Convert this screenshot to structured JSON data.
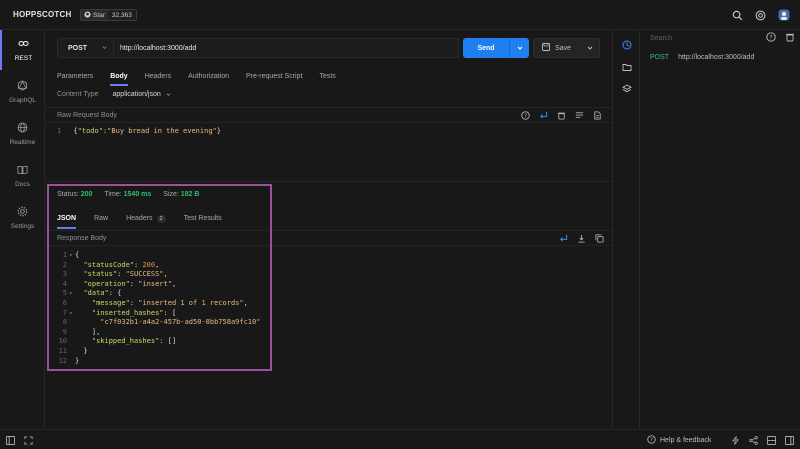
{
  "app": {
    "brand": "HOPPSCOTCH",
    "github": {
      "star_label": "Star",
      "star_count": "32,363"
    }
  },
  "sidebar": {
    "items": [
      {
        "label": "REST",
        "icon": "link-icon",
        "active": true
      },
      {
        "label": "GraphQL",
        "icon": "graphql-icon",
        "active": false
      },
      {
        "label": "Realtime",
        "icon": "globe-icon",
        "active": false
      },
      {
        "label": "Docs",
        "icon": "book-icon",
        "active": false
      },
      {
        "label": "Settings",
        "icon": "gear-icon",
        "active": false
      }
    ]
  },
  "request": {
    "method": "POST",
    "url": "http://localhost:3000/add",
    "send_label": "Send",
    "save_label": "Save",
    "tabs": [
      "Parameters",
      "Body",
      "Headers",
      "Authorization",
      "Pre-request Script",
      "Tests"
    ],
    "active_tab": "Body",
    "content_type_label": "Content Type",
    "content_type_value": "application/json",
    "raw_body_label": "Raw Request Body",
    "body_line_no": "1",
    "body_key": "\"todo\"",
    "body_value": "\"Buy bread in the evening\""
  },
  "response": {
    "status_label": "Status:",
    "status_value": "200",
    "time_label": "Time:",
    "time_value": "1540 ms",
    "size_label": "Size:",
    "size_value": "182 B",
    "tabs": [
      "JSON",
      "Raw",
      "Headers",
      "Test Results"
    ],
    "headers_count": "2",
    "body_label": "Response Body",
    "lines": [
      {
        "n": "1",
        "fold": "▾",
        "t": "{"
      },
      {
        "n": "2",
        "fold": "",
        "t": "  \"statusCode\": 200,"
      },
      {
        "n": "3",
        "fold": "",
        "t": "  \"status\": \"SUCCESS\","
      },
      {
        "n": "4",
        "fold": "",
        "t": "  \"operation\": \"insert\","
      },
      {
        "n": "5",
        "fold": "▾",
        "t": "  \"data\": {"
      },
      {
        "n": "6",
        "fold": "",
        "t": "    \"message\": \"inserted 1 of 1 records\","
      },
      {
        "n": "7",
        "fold": "▾",
        "t": "    \"inserted_hashes\": ["
      },
      {
        "n": "8",
        "fold": "",
        "t": "      \"c7f032b1-a4a2-457b-ad50-8bb758a9fc10\""
      },
      {
        "n": "9",
        "fold": "",
        "t": "    ],"
      },
      {
        "n": "10",
        "fold": "",
        "t": "    \"skipped_hashes\": []"
      },
      {
        "n": "11",
        "fold": "",
        "t": "  }"
      },
      {
        "n": "12",
        "fold": "",
        "t": "}"
      }
    ]
  },
  "history": {
    "search_placeholder": "Search",
    "items": [
      {
        "method": "POST",
        "url": "http://localhost:3000/add"
      }
    ]
  },
  "footer": {
    "help_label": "Help & feedback"
  },
  "colors": {
    "accent": "#1f7ef0",
    "active_tab": "#6c7bf2",
    "success": "#2fbf71",
    "highlight_box": "#9b4f9d"
  }
}
